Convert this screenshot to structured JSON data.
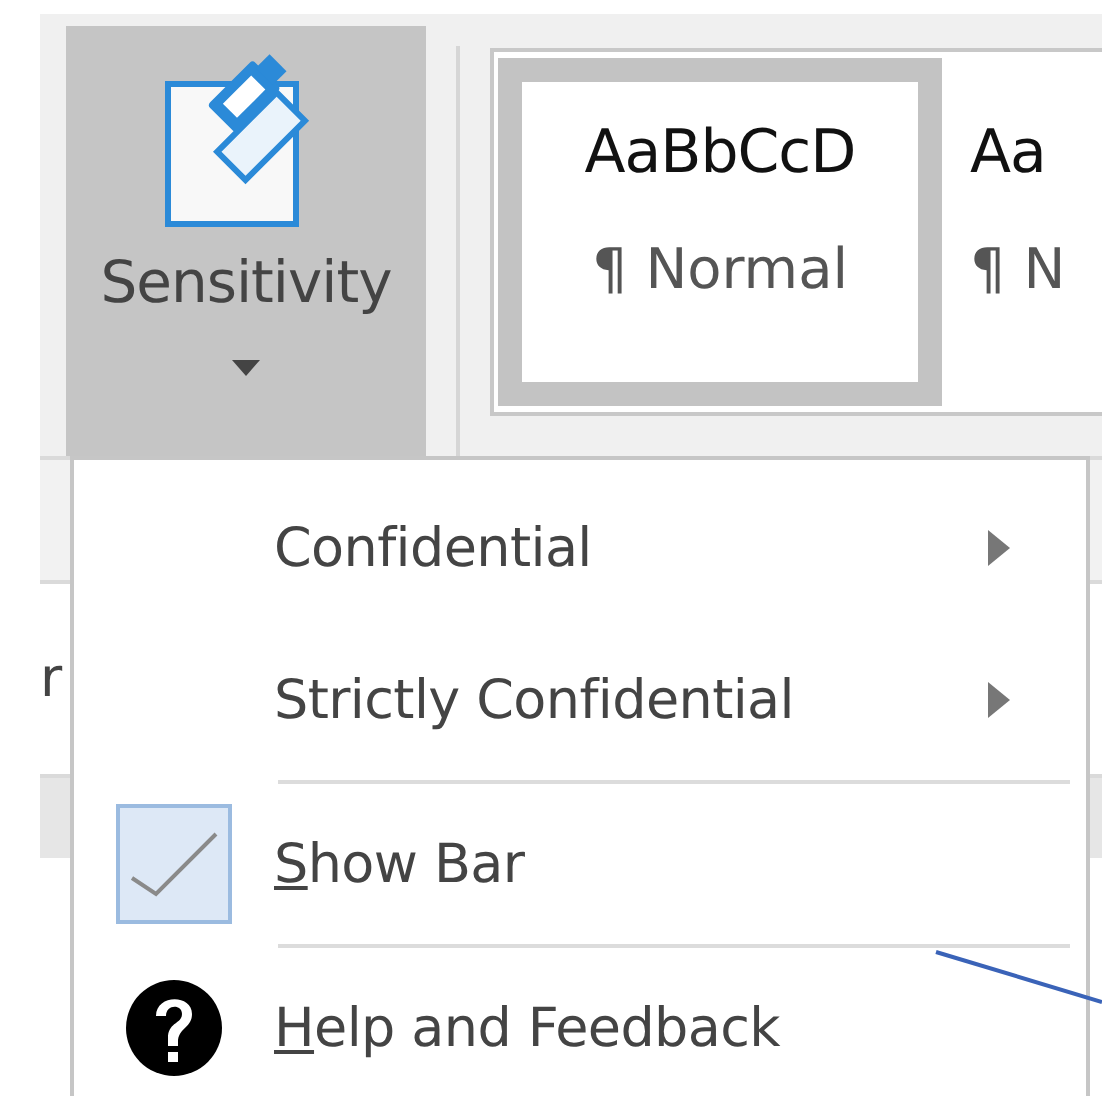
{
  "ribbon": {
    "sensitivity_button": {
      "label": "Sensitivity",
      "pressed": true
    },
    "styles_gallery": [
      {
        "sample": "AaBbCcD",
        "name": "¶ Normal",
        "selected": true
      },
      {
        "sample": "Aa",
        "name": "¶ N",
        "selected": false
      }
    ]
  },
  "background_text": "r",
  "menu": {
    "items": [
      {
        "kind": "submenu",
        "label": "Confidential"
      },
      {
        "kind": "submenu",
        "label": "Strictly Confidential"
      },
      {
        "kind": "separator"
      },
      {
        "kind": "check",
        "label": "Show Bar",
        "checked": true,
        "underline_first": true
      },
      {
        "kind": "separator"
      },
      {
        "kind": "help",
        "label": "Help and Feedback",
        "underline_first": true
      }
    ]
  }
}
